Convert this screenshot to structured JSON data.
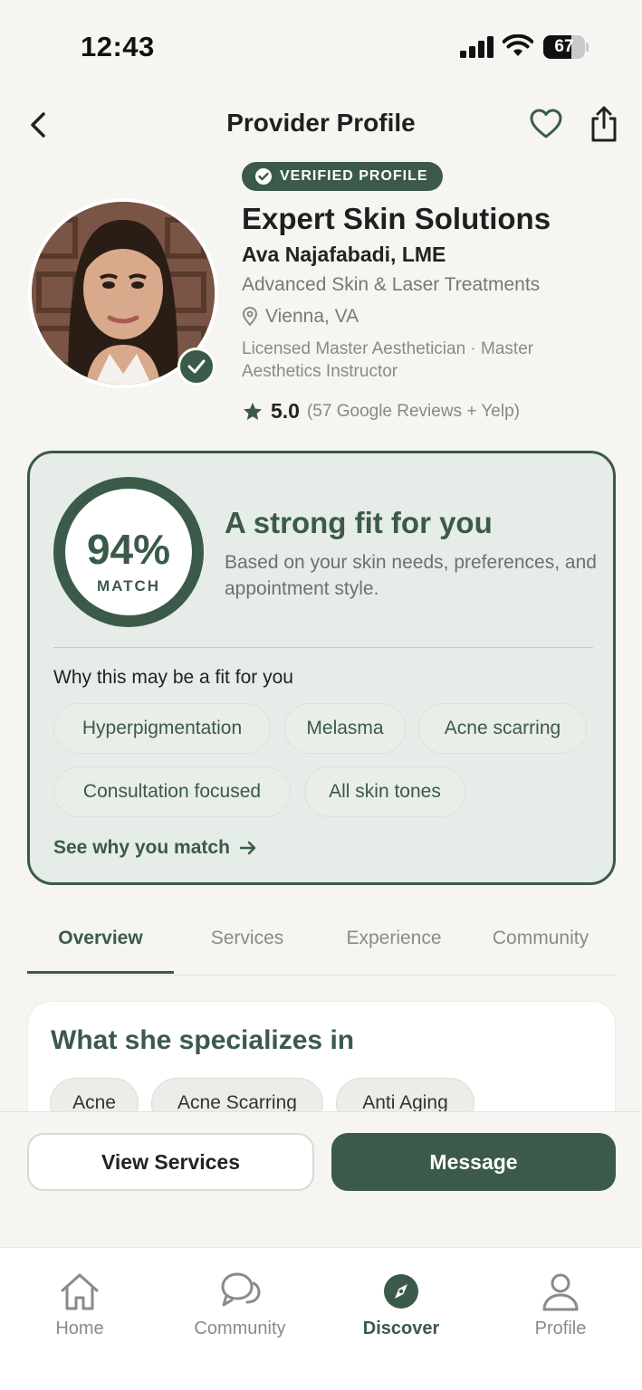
{
  "status_bar": {
    "time": "12:43",
    "battery": "67",
    "battery_level": 0.67
  },
  "header": {
    "title": "Provider Profile"
  },
  "profile": {
    "verified_label": "VERIFIED PROFILE",
    "name": "Expert Skin Solutions",
    "person": "Ava Najafabadi, LME",
    "subtitle": "Advanced Skin & Laser Treatments",
    "location": "Vienna, VA",
    "credentials": "Licensed Master Aesthetician · Master Aesthetics Instructor",
    "rating": "5.0",
    "reviews": "(57 Google Reviews + Yelp)"
  },
  "match": {
    "percent": "94%",
    "label": "MATCH",
    "level": 0.94,
    "headline": "A strong fit for you",
    "description": "Based on your skin needs, preferences, and appointment style.",
    "why_heading": "Why this may be a fit for you",
    "chips": [
      "Hyperpigmentation",
      "Melasma",
      "Acne scarring",
      "Consultation focused",
      "All skin tones"
    ],
    "see_why": "See why you match"
  },
  "tabs": [
    "Overview",
    "Services",
    "Experience",
    "Community"
  ],
  "specialties": {
    "title": "What she specializes in",
    "chips": [
      "Acne",
      "Acne Scarring",
      "Anti Aging"
    ]
  },
  "actions": {
    "view_services": "View Services",
    "message": "Message"
  },
  "bottom_nav": [
    {
      "label": "Home",
      "icon": "home-icon"
    },
    {
      "label": "Community",
      "icon": "chat-icon"
    },
    {
      "label": "Discover",
      "icon": "compass-icon"
    },
    {
      "label": "Profile",
      "icon": "person-icon"
    }
  ],
  "colors": {
    "accent": "#3b5a49",
    "background": "#f6f5f1",
    "match_card": "#e6ece7"
  }
}
